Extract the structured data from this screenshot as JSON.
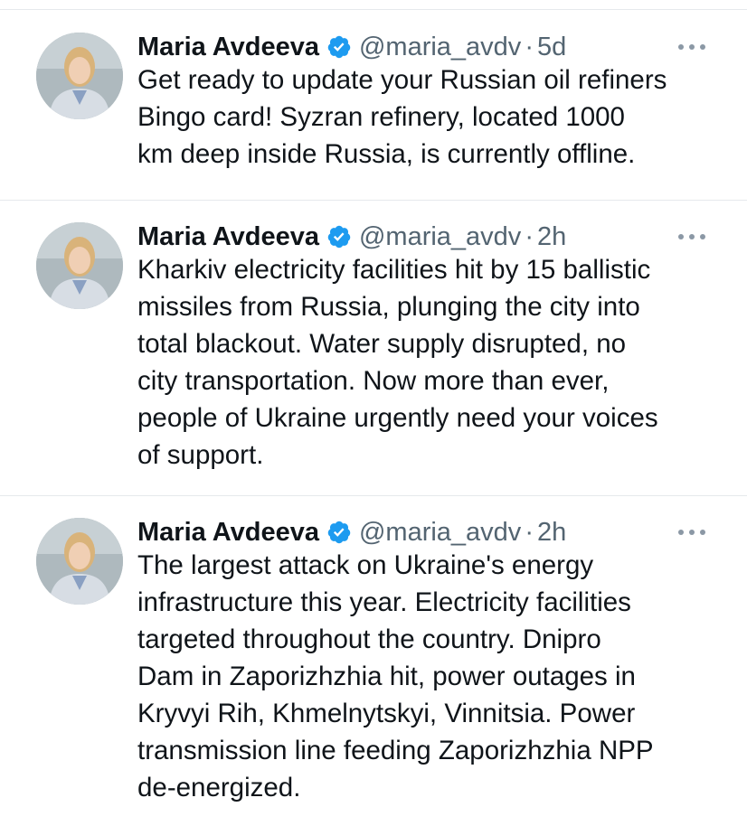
{
  "tweets": [
    {
      "author_name": "Maria Avdeeva",
      "handle": "@maria_avdv",
      "separator": "·",
      "time": "5d",
      "text": "Get ready to update your Russian oil refiners\nBingo card! Syzran refinery, located 1000\nkm deep inside Russia, is currently offline."
    },
    {
      "author_name": "Maria Avdeeva",
      "handle": "@maria_avdv",
      "separator": "·",
      "time": "2h",
      "text": "Kharkiv electricity facilities hit by 15 ballistic\nmissiles from Russia, plunging the city into\ntotal blackout. Water supply disrupted, no\ncity transportation. Now more than ever,\npeople of Ukraine urgently need your voices\nof support."
    },
    {
      "author_name": "Maria Avdeeva",
      "handle": "@maria_avdv",
      "separator": "·",
      "time": "2h",
      "text": "The largest attack on Ukraine's energy\ninfrastructure this year. Electricity facilities\ntargeted throughout the country. Dnipro\nDam in Zaporizhzhia hit, power outages in\nKryvyi Rih, Khmelnytskyi, Vinnitsia. Power\ntransmission line feeding Zaporizhzhia NPP\nde-energized."
    }
  ],
  "colors": {
    "verified_badge": "#1d9bf0",
    "secondary_text": "#536471",
    "primary_text": "#0f1419",
    "divider": "#e6e9ec"
  },
  "icons": {
    "verified": "verified-badge-icon",
    "more": "more-options-icon"
  }
}
